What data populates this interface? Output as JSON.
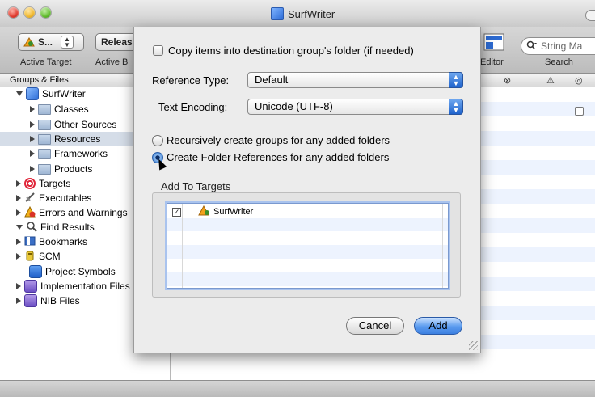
{
  "window": {
    "title": "SurfWriter"
  },
  "toolbar": {
    "target_popup_label": "S...",
    "config_popup_label": "Releas",
    "active_target_label": "Active Target",
    "active_build_label": "Active B",
    "editor_label": "Editor",
    "search_label": "Search",
    "search_placeholder": "String Ma"
  },
  "sidebar": {
    "header": "Groups & Files",
    "items": [
      {
        "label": "SurfWriter",
        "icon": "project-icon",
        "expanded": true
      },
      {
        "label": "Classes",
        "icon": "folder-icon"
      },
      {
        "label": "Other Sources",
        "icon": "folder-icon"
      },
      {
        "label": "Resources",
        "icon": "folder-icon",
        "selected": true
      },
      {
        "label": "Frameworks",
        "icon": "folder-icon"
      },
      {
        "label": "Products",
        "icon": "folder-icon"
      },
      {
        "label": "Targets",
        "icon": "target-icon"
      },
      {
        "label": "Executables",
        "icon": "executables-icon"
      },
      {
        "label": "Errors and Warnings",
        "icon": "warning-icon"
      },
      {
        "label": "Find Results",
        "icon": "magnifier-icon"
      },
      {
        "label": "Bookmarks",
        "icon": "bookmarks-icon"
      },
      {
        "label": "SCM",
        "icon": "scm-icon"
      },
      {
        "label": "Project Symbols",
        "icon": "symbols-icon"
      },
      {
        "label": "Implementation Files",
        "icon": "smart-group-icon"
      },
      {
        "label": "NIB Files",
        "icon": "smart-group-icon"
      }
    ]
  },
  "dialog": {
    "copy_items_label": "Copy items into destination group's folder (if needed)",
    "copy_items_checked": false,
    "reference_type_label": "Reference Type:",
    "reference_type_value": "Default",
    "text_encoding_label": "Text Encoding:",
    "text_encoding_value": "Unicode (UTF-8)",
    "radio_recursive_label": "Recursively create groups for any added folders",
    "radio_references_label": "Create Folder References for any added folders",
    "selected_radio": "references",
    "add_to_targets_title": "Add To Targets",
    "targets": [
      {
        "name": "SurfWriter",
        "checked": true
      }
    ],
    "cancel_label": "Cancel",
    "add_label": "Add"
  },
  "colors": {
    "selection": "#d5dde8",
    "stripe": "#edf3fe",
    "default_button": "#3c7fe0"
  }
}
